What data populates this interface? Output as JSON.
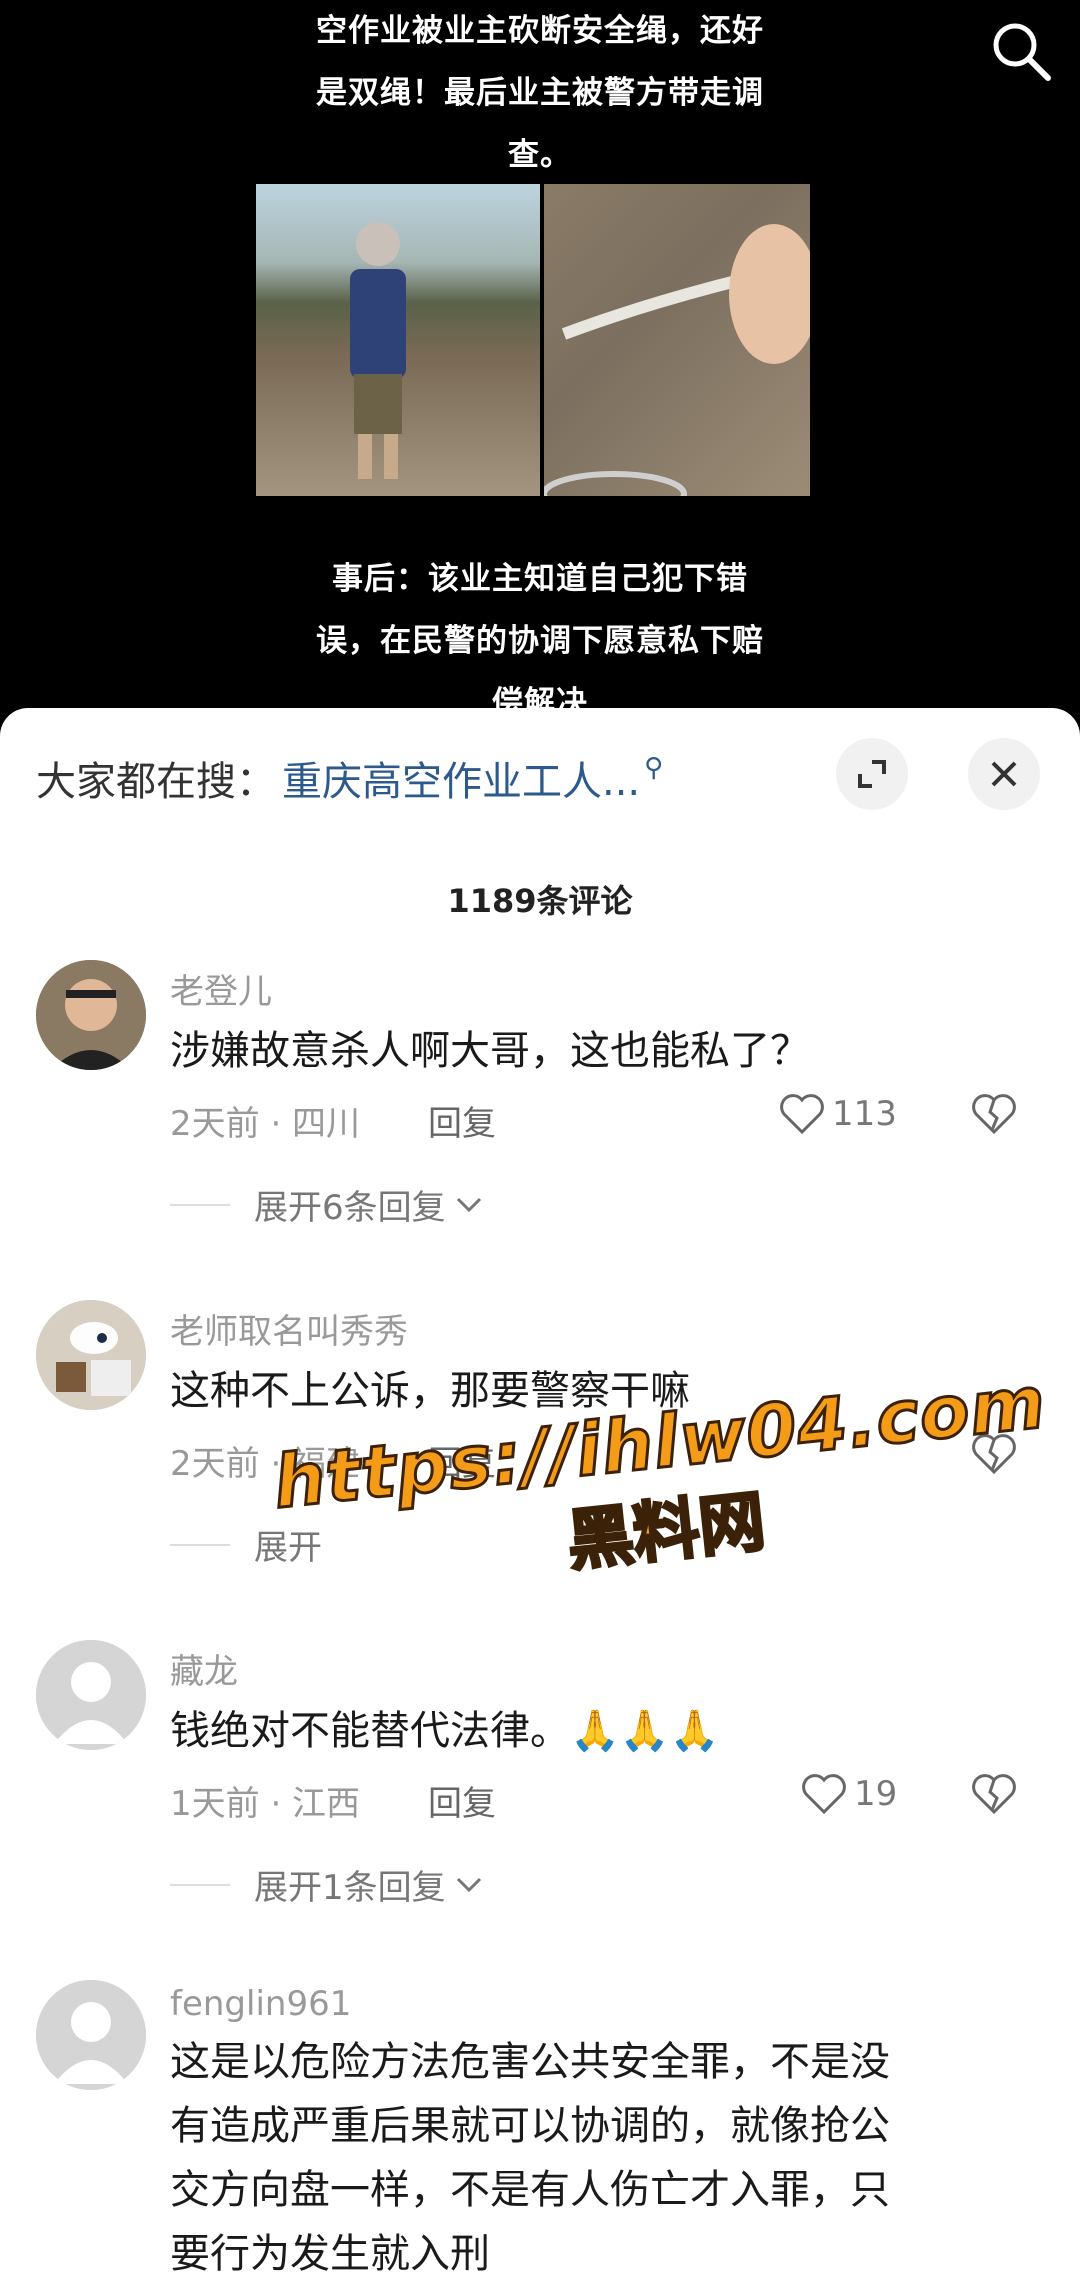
{
  "video": {
    "caption_top": [
      "空作业被业主砍断安全绳，还好",
      "是双绳！最后业主被警方带走调",
      "查。"
    ],
    "caption_bottom": [
      "事后：该业主知道自己犯下错",
      "误，在民警的协调下愿意私下赔",
      "偿解决"
    ]
  },
  "sheet": {
    "hot_label": "大家都在搜：",
    "hot_keyword": "重庆高空作业工人...",
    "comment_count": "1189条评论"
  },
  "comments": [
    {
      "user": "老登儿",
      "text": "涉嫌故意杀人啊大哥，这也能私了？",
      "meta": "2天前 · 四川",
      "reply": "回复",
      "likes": "113",
      "expand": "展开6条回复"
    },
    {
      "user": "老师取名叫秀秀",
      "text": "这种不上公诉，那要警察干嘛",
      "meta": "2天前 · 福建",
      "reply": "回复",
      "expand": "展开"
    },
    {
      "user": "藏龙",
      "text": "钱绝对不能替代法律。",
      "emoji": "🙏🙏🙏",
      "meta": "1天前 · 江西",
      "reply": "回复",
      "likes": "19",
      "expand": "展开1条回复"
    },
    {
      "user": "fenglin961",
      "lines": [
        "这是以危险方法危害公共安全罪，不是没",
        "有造成严重后果就可以协调的，就像抢公",
        "交方向盘一样，不是有人伤亡才入罪，只",
        "要行为发生就入刑"
      ]
    }
  ],
  "watermark": {
    "url": "https://ihlw04.com",
    "text": "黑料网"
  },
  "colors": {
    "keyword": "#2c5a8c",
    "watermark": "#f49b17"
  }
}
